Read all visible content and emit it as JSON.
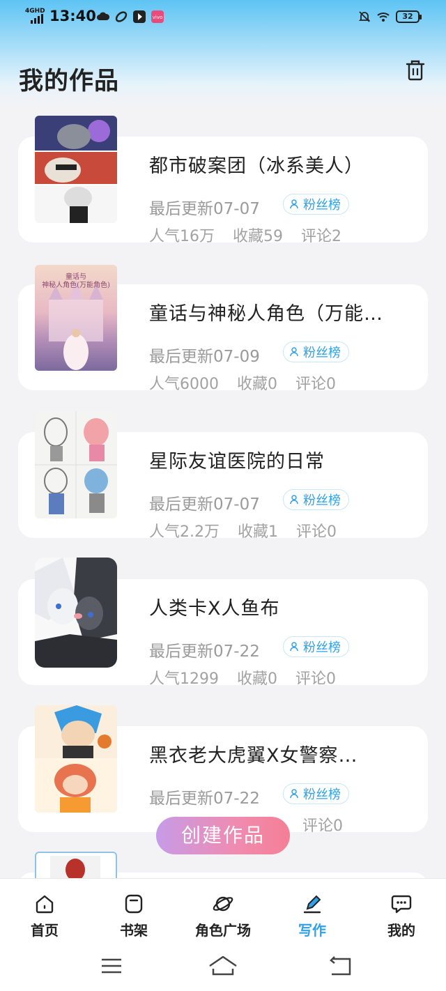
{
  "status_bar": {
    "network": "4GHD",
    "time": "13:40",
    "battery": "32",
    "icons": [
      "cloud-icon",
      "leaf-app-icon",
      "play-icon",
      "vivo-app-icon",
      "mute-icon",
      "wifi-icon"
    ]
  },
  "page": {
    "title": "我的作品",
    "delete_icon": "trash-icon"
  },
  "works": [
    {
      "title": "都市破案团（冰系美人）",
      "update": "最后更新07-07",
      "badge": "粉丝榜",
      "popularity": "人气16万",
      "favorites": "收藏59",
      "comments": "评论2"
    },
    {
      "title": "童话与神秘人角色（万能角色）",
      "update": "最后更新07-09",
      "badge": "粉丝榜",
      "popularity": "人气6000",
      "favorites": "收藏0",
      "comments": "评论0",
      "cover_text": "童话与\n神秘人角色(万能角色)"
    },
    {
      "title": "星际友谊医院的日常",
      "update": "最后更新07-07",
      "badge": "粉丝榜",
      "popularity": "人气2.2万",
      "favorites": "收藏1",
      "comments": "评论0"
    },
    {
      "title": "人类卡X人鱼布",
      "update": "最后更新07-22",
      "badge": "粉丝榜",
      "popularity": "人气1299",
      "favorites": "收藏0",
      "comments": "评论0"
    },
    {
      "title": "黑衣老大虎翼X女警察…",
      "update": "最后更新07-22",
      "badge": "粉丝榜",
      "popularity": "",
      "favorites": "",
      "comments": "评论0"
    }
  ],
  "create_button": "创建作品",
  "bottom_nav": [
    {
      "label": "首页",
      "icon": "home-icon"
    },
    {
      "label": "书架",
      "icon": "bookshelf-icon"
    },
    {
      "label": "角色广场",
      "icon": "planet-icon"
    },
    {
      "label": "写作",
      "icon": "pen-icon",
      "active": true
    },
    {
      "label": "我的",
      "icon": "chat-bubble-icon"
    }
  ],
  "colors": {
    "accent": "#2ea1e8",
    "header_top": "#5ec4f4",
    "create_gradient_start": "#c79be8",
    "create_gradient_end": "#f47f95"
  }
}
